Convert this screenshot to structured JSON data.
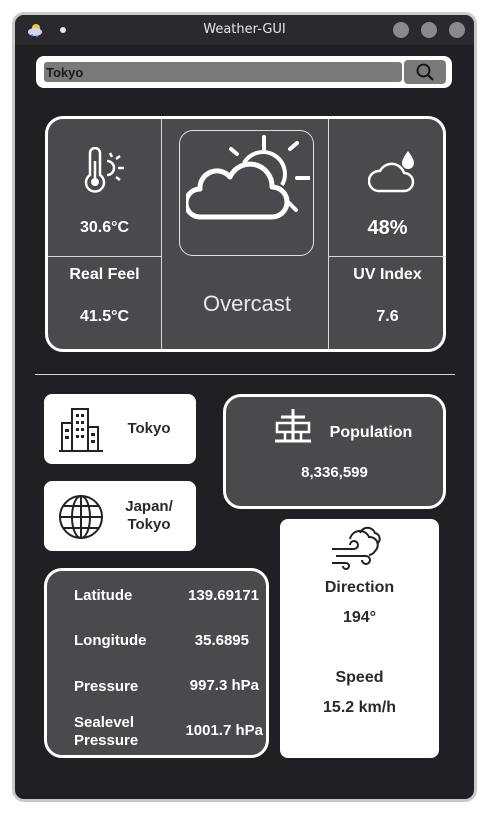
{
  "window": {
    "title": "Weather-GUI"
  },
  "search": {
    "value": "Tokyo",
    "button_icon": "search-icon"
  },
  "weather": {
    "temperature": "30.6°C",
    "real_feel_label": "Real Feel",
    "real_feel": "41.5°C",
    "condition": "Overcast",
    "humidity": "48%",
    "uv_label": "UV Index",
    "uv_index": "7.6"
  },
  "location": {
    "city": "Tokyo",
    "region_line1": "Japan/",
    "region_line2": "Tokyo",
    "population_label": "Population",
    "population": "8,336,599"
  },
  "coordinates": {
    "latitude_label": "Latitude",
    "latitude": "139.69171",
    "longitude_label": "Longitude",
    "longitude": "35.6895",
    "pressure_label": "Pressure",
    "pressure": "997.3 hPa",
    "sealevel_label_line1": "Sealevel",
    "sealevel_label_line2": "Pressure",
    "sealevel": "1001.7 hPa"
  },
  "wind": {
    "direction_label": "Direction",
    "direction": "194°",
    "speed_label": "Speed",
    "speed": "15.2 km/h"
  },
  "colors": {
    "background": "#1f1f24",
    "panel": "#4a4a4e",
    "card": "#ffffff",
    "border": "#ffffff"
  }
}
